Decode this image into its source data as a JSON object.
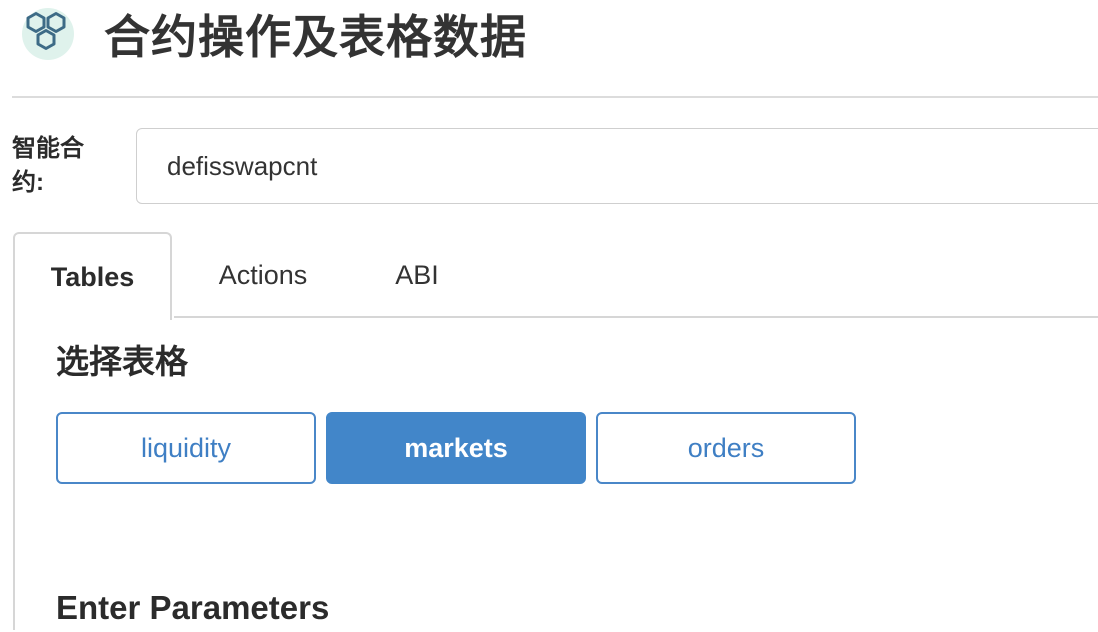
{
  "header": {
    "title": "合约操作及表格数据",
    "logo_icon": "hexagon-cluster-icon"
  },
  "contract": {
    "label": "智能合约:",
    "value": "defisswapcnt"
  },
  "tabs": [
    {
      "label": "Tables",
      "active": true
    },
    {
      "label": "Actions",
      "active": false
    },
    {
      "label": "ABI",
      "active": false
    }
  ],
  "tables_panel": {
    "section_title": "选择表格",
    "table_buttons": [
      {
        "label": "liquidity",
        "selected": false
      },
      {
        "label": "markets",
        "selected": true
      },
      {
        "label": "orders",
        "selected": false
      }
    ],
    "params_title": "Enter Parameters"
  },
  "colors": {
    "accent": "#4286c9",
    "accent_text": "#3f7fc4",
    "logo_fill": "#dff2ec",
    "logo_stroke": "#3d6b86"
  }
}
